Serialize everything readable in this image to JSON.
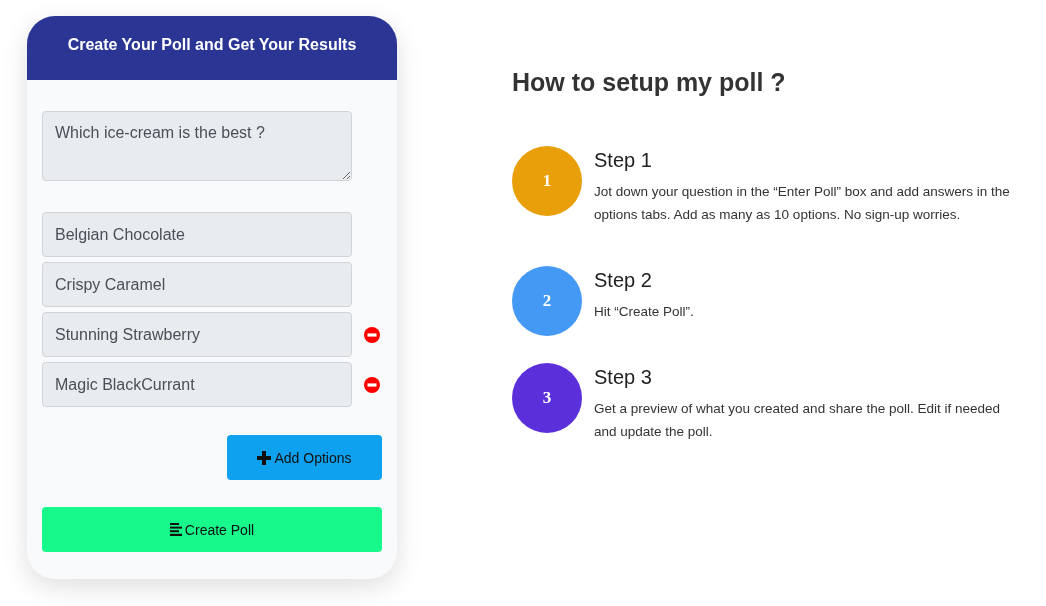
{
  "card": {
    "title": "Create Your Poll and Get Your Results"
  },
  "question": {
    "value": "Which ice-cream is the best ?"
  },
  "options": [
    {
      "value": "Belgian Chocolate",
      "removable": false
    },
    {
      "value": "Crispy Caramel",
      "removable": false
    },
    {
      "value": "Stunning Strawberry",
      "removable": true
    },
    {
      "value": "Magic BlackCurrant",
      "removable": true
    }
  ],
  "buttons": [
    {
      "kind": "add_option",
      "label": "Add Options"
    },
    {
      "kind": "create_poll",
      "label": "Create Poll"
    }
  ],
  "guide": {
    "heading": "How to setup my poll ?",
    "steps": [
      {
        "number": "1",
        "title": "Step 1",
        "description": "Jot down your question in the “Enter Poll” box and add answers in the options tabs. Add as many as 10 options. No sign-up worries.",
        "color": "#e89f0a"
      },
      {
        "number": "2",
        "title": "Step 2",
        "description": "Hit “Create Poll”.",
        "color": "#4499f5"
      },
      {
        "number": "3",
        "title": "Step 3",
        "description": "Get a preview of what you created and share the poll. Edit if needed and update the poll.",
        "color": "#5b2fd9"
      }
    ]
  }
}
